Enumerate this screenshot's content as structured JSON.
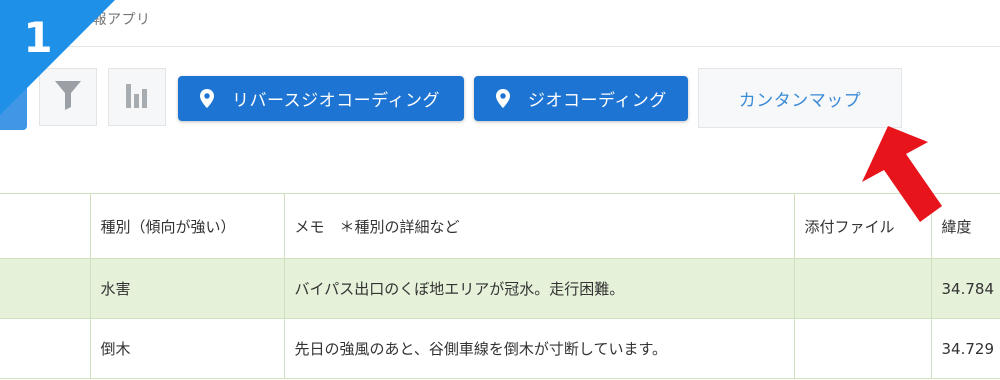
{
  "app": {
    "title_visible": "情報アプリ",
    "step_number": "1"
  },
  "toolbar": {
    "reverse_geocoding_label": "リバースジオコーディング",
    "geocoding_label": "ジオコーディング",
    "kantan_map_label": "カンタンマップ"
  },
  "table": {
    "headers": {
      "col0": "",
      "type": "種別（傾向が強い）",
      "memo": "メモ　＊種別の詳細など",
      "attachment": "添付ファイル",
      "latitude": "緯度"
    },
    "rows": [
      {
        "type": "水害",
        "memo": "バイパス出口のくぼ地エリアが冠水。走行困難。",
        "attachment": "",
        "latitude": "34.784"
      },
      {
        "type": "倒木",
        "memo": "先日の強風のあと、谷側車線を倒木が寸断しています。",
        "attachment": "",
        "latitude": "34.729"
      }
    ]
  },
  "colors": {
    "primary_button": "#1e74d3",
    "badge": "#1e90e8",
    "highlight_row": "#e5f1d9",
    "annotation_arrow": "#e8141b"
  },
  "icons": [
    "filter-icon",
    "bar-chart-icon",
    "map-pin-icon",
    "red-arrow-annotation"
  ]
}
